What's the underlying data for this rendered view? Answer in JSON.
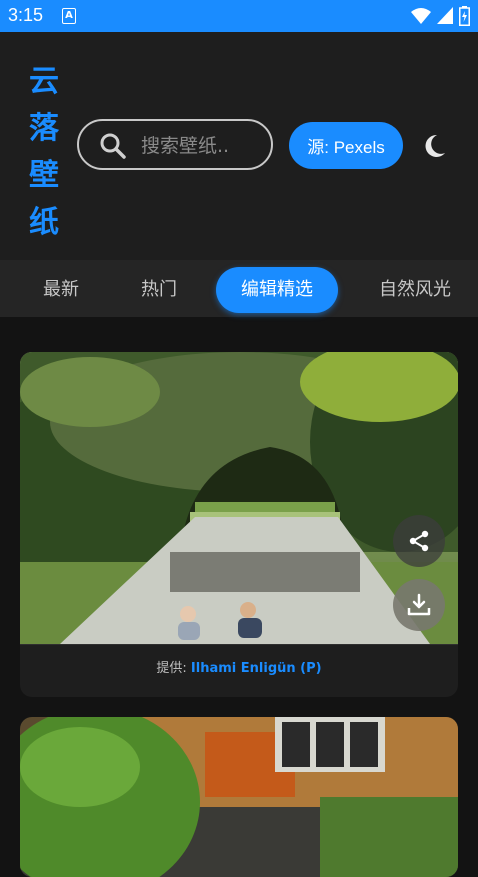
{
  "status_bar": {
    "time": "3:15",
    "notification_icon_letter": "A"
  },
  "app": {
    "title_chars": [
      "云",
      "落",
      "壁",
      "纸"
    ],
    "accent_color": "#1a8cff"
  },
  "search": {
    "placeholder": "搜索壁纸..",
    "icon": "search-icon"
  },
  "source_button": {
    "label": "源: Pexels"
  },
  "theme_toggle": {
    "icon": "moon-icon"
  },
  "tabs": [
    {
      "label": "最新",
      "active": false
    },
    {
      "label": "热门",
      "active": false
    },
    {
      "label": "编辑精选",
      "active": true
    },
    {
      "label": "自然风光",
      "active": false
    }
  ],
  "cards": [
    {
      "credit_prefix": "提供: ",
      "author": "Ilhami Enligün (P)",
      "actions": [
        "share-icon",
        "download-icon"
      ]
    },
    {
      "credit_prefix": "",
      "author": ""
    }
  ]
}
